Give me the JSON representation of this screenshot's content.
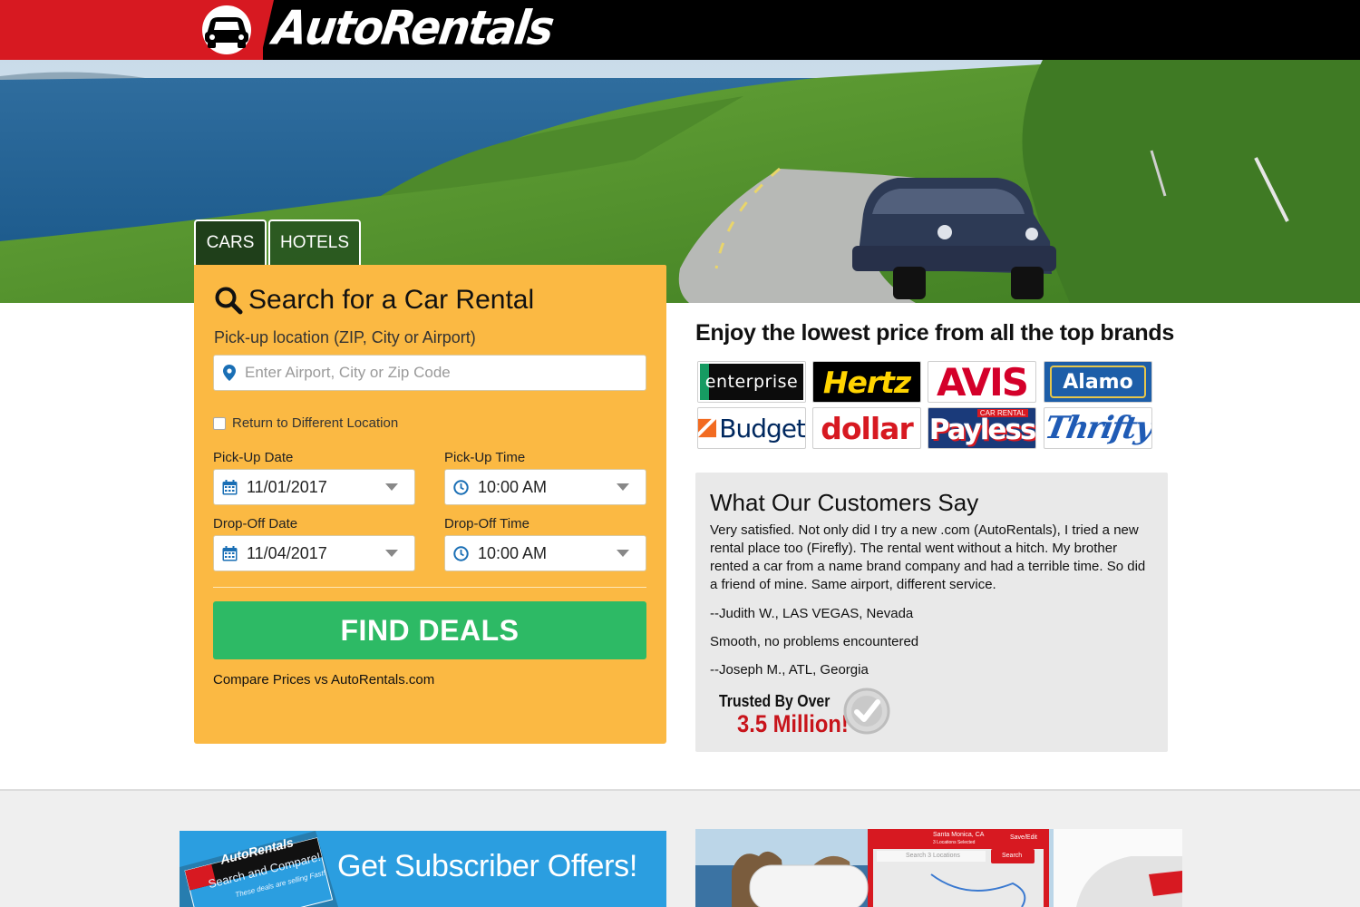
{
  "brand": {
    "name": "AutoRentals"
  },
  "tabs": {
    "cars": "CARS",
    "hotels": "HOTELS"
  },
  "search": {
    "title": "Search for a Car Rental",
    "location_label": "Pick-up location (ZIP, City or Airport)",
    "location_placeholder": "Enter Airport, City or Zip Code",
    "return_label": "Return to Different Location",
    "pickup_date_label": "Pick-Up Date",
    "pickup_date": "11/01/2017",
    "pickup_time_label": "Pick-Up Time",
    "pickup_time": "10:00 AM",
    "dropoff_date_label": "Drop-Off Date",
    "dropoff_date": "11/04/2017",
    "dropoff_time_label": "Drop-Off Time",
    "dropoff_time": "10:00 AM",
    "button": "FIND DEALS",
    "compare": "Compare Prices vs AutoRentals.com"
  },
  "brands": {
    "title": "Enjoy the lowest price from all the top brands",
    "items": [
      "enterprise",
      "Hertz",
      "AVIS",
      "Alamo",
      "Budget",
      "dollar",
      "Payless",
      "Thrifty"
    ],
    "payless_sub": "CAR RENTAL"
  },
  "testimonials": {
    "title": "What Our Customers Say",
    "quote1": "Very satisfied. Not only did I try a new .com (AutoRentals), I tried a new rental place too (Firefly). The rental went without a hitch. My brother rented a car from a name brand company and had a terrible time. So did a friend of mine. Same airport, different service.",
    "author1": "--Judith W., LAS VEGAS, Nevada",
    "quote2": "Smooth, no problems encountered",
    "author2": "--Joseph M., ATL, Georgia",
    "trusted_line1": "Trusted By Over",
    "trusted_line2": "3.5 Million!"
  },
  "promo": {
    "text": "Get Subscriber Offers!",
    "badge_title": "AutoRentals",
    "badge_sub": "Search and Compare!",
    "badge_small": "These deals are selling Fast!"
  },
  "app_preview": {
    "location": "Santa Monica, CA",
    "save": "Save/Edit",
    "selected": "3 Locations Selected",
    "search_label": "Search 3 Locations",
    "search_btn": "Search"
  },
  "colors": {
    "header_red": "#d71921",
    "panel_orange": "#fbb943",
    "find_green": "#2dba65",
    "promo_blue": "#2b9ee0"
  },
  "icons": [
    "car-logo-icon",
    "search-icon",
    "map-pin-icon",
    "calendar-icon",
    "clock-icon",
    "chevron-down-icon",
    "checkmark-seal-icon"
  ]
}
